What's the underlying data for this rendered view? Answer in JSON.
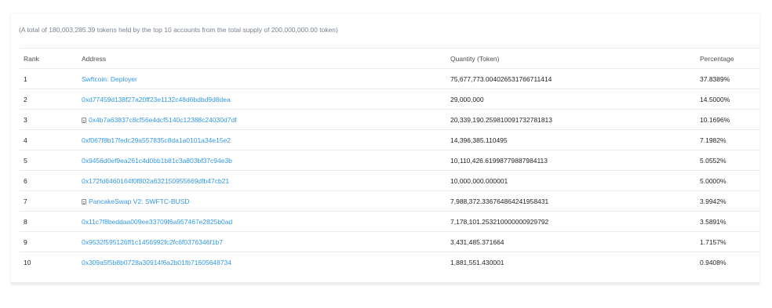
{
  "summary": "(A total of 180,003,285.39 tokens held by the top 10 accounts from the total supply of 200,000,000.00 token)",
  "table": {
    "headers": {
      "rank": "Rank",
      "address": "Address",
      "quantity": "Quantity (Token)",
      "percentage": "Percentage"
    },
    "rows": [
      {
        "rank": "1",
        "address": "Swftcoin: Deployer",
        "contract": false,
        "quantity": "75,677,773.004026531766711414",
        "percentage": "37.8389%"
      },
      {
        "rank": "2",
        "address": "0xd77459d138f27a20ff23e1132c48d6bdbd9d8dea",
        "contract": false,
        "quantity": "29,000,000",
        "percentage": "14.5000%"
      },
      {
        "rank": "3",
        "address": "0x4b7a63837c8cf56e4dcf5140c12388c24030d7df",
        "contract": true,
        "quantity": "20,339,190.259810091732781813",
        "percentage": "10.1696%"
      },
      {
        "rank": "4",
        "address": "0xf067f8b17fedc29a557835c8da1a0101a34e15e2",
        "contract": false,
        "quantity": "14,396,385.110495",
        "percentage": "7.1982%"
      },
      {
        "rank": "5",
        "address": "0x9456d0ef9ea261c4d0bb1b81c3a803bf37c94e3b",
        "contract": false,
        "quantity": "10,110,426.61998779887984113",
        "percentage": "5.0552%"
      },
      {
        "rank": "6",
        "address": "0x172fd6460164f0f802a632150955669dfb47cb21",
        "contract": false,
        "quantity": "10,000,000.000001",
        "percentage": "5.0000%"
      },
      {
        "rank": "7",
        "address": "PancakeSwap V2: SWFTC-BUSD",
        "contract": true,
        "quantity": "7,988,372.336764864241958431",
        "percentage": "3.9942%"
      },
      {
        "rank": "8",
        "address": "0x11c7f8beddaa009ee33709f6a957467e2825b0ad",
        "contract": false,
        "quantity": "7,178,101.253210000000929792",
        "percentage": "3.5891%"
      },
      {
        "rank": "9",
        "address": "0x9532f595126ff1c1456992fc2fc6f0376346f1b7",
        "contract": false,
        "quantity": "3,431,485.371664",
        "percentage": "1.7157%"
      },
      {
        "rank": "10",
        "address": "0x309a5f5b8b0728a30914f6a2b01fb71605648734",
        "contract": false,
        "quantity": "1,881,551.430001",
        "percentage": "0.9408%"
      }
    ]
  },
  "colors": {
    "link": "#3498db",
    "text": "#1e2022",
    "muted": "#77838f",
    "border": "#e7eaf3"
  },
  "icons": {
    "contract": "contract-doc-icon"
  }
}
